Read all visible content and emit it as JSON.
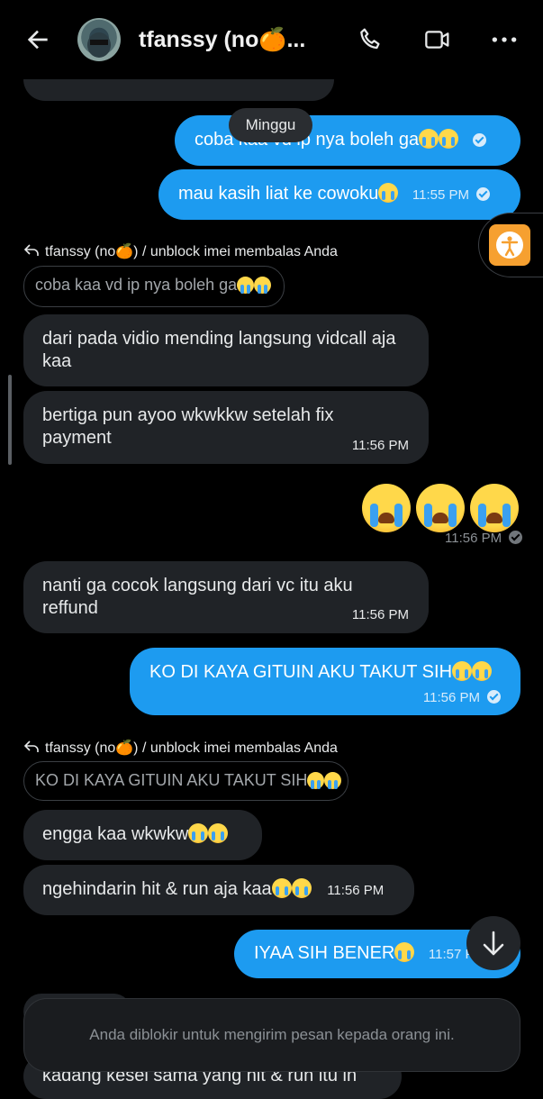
{
  "header": {
    "title": "tfanssy (no🍊...",
    "back_icon": "arrow-left-icon",
    "call_icon": "phone-icon",
    "video_icon": "video-camera-icon",
    "more_icon": "more-horizontal-icon"
  },
  "date_chip": "Minggu",
  "messages": {
    "m1": {
      "text": "coba kaa vd ip nya boleh ga"
    },
    "m2": {
      "text": "mau kasih liat ke cowoku",
      "time": "11:55 PM"
    },
    "reply1": {
      "header": "tfanssy (no🍊) / unblock imei membalas Anda",
      "quote": "coba kaa vd ip nya boleh ga"
    },
    "m3": {
      "text": "dari pada vidio mending langsung vidcall aja kaa"
    },
    "m4": {
      "text": "bertiga pun ayoo wkwkkw setelah fix payment",
      "time": "11:56 PM"
    },
    "m5": {
      "time": "11:56 PM"
    },
    "m6": {
      "text": "nanti ga cocok langsung dari vc itu aku reffund",
      "time": "11:56 PM"
    },
    "m7": {
      "text": "KO DI KAYA GITUIN AKU TAKUT SIH",
      "time": "11:56 PM"
    },
    "reply2": {
      "header": "tfanssy (no🍊) / unblock imei membalas Anda",
      "quote": "KO DI KAYA GITUIN AKU TAKUT SIH"
    },
    "m8": {
      "text": "engga kaa wkwkw"
    },
    "m9": {
      "text": "ngehindarin hit & run aja kaa",
      "time": "11:56 PM"
    },
    "m10": {
      "text": "IYAA SIH BENER",
      "time": "11:57 PM"
    },
    "m11": {
      "text": "kadang kesel sama yang hit & run itu in"
    }
  },
  "blocked_notice": "Anda diblokir untuk mengirim pesan kepada orang ini.",
  "colors": {
    "accent": "#1d9bf0",
    "incoming_bubble": "#202327",
    "background": "#000000"
  }
}
